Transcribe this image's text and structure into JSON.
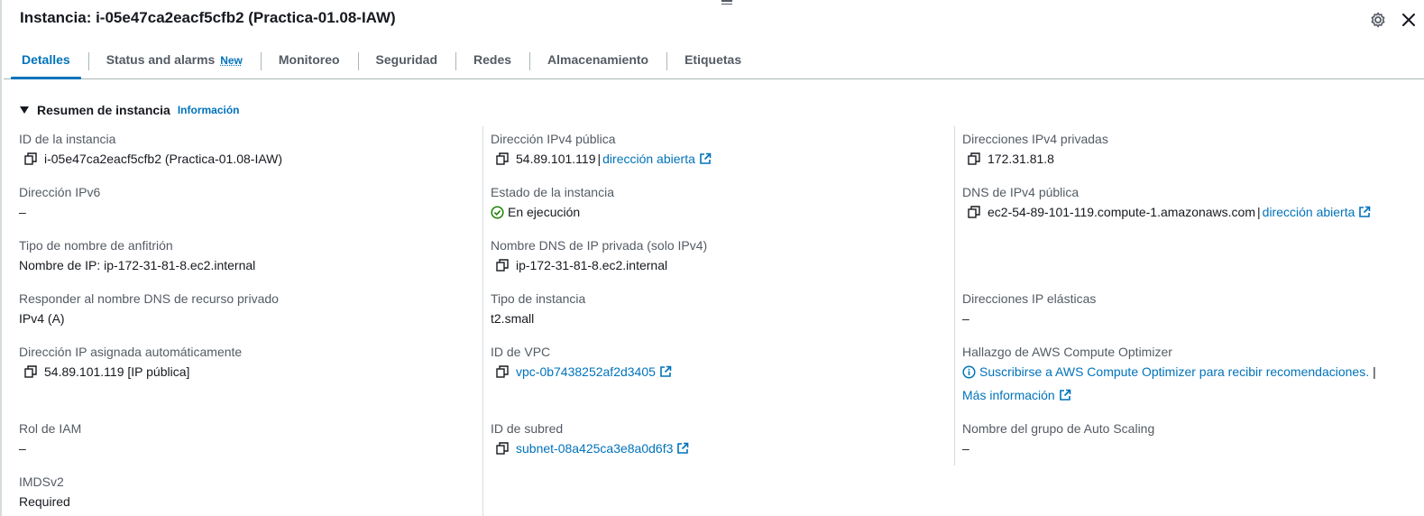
{
  "header": {
    "title": "Instancia: i-05e47ca2eacf5cfb2 (Practica-01.08-IAW)"
  },
  "tabs": [
    {
      "label": "Detalles",
      "active": true
    },
    {
      "label": "Status and alarms",
      "badge": "New"
    },
    {
      "label": "Monitoreo"
    },
    {
      "label": "Seguridad"
    },
    {
      "label": "Redes"
    },
    {
      "label": "Almacenamiento"
    },
    {
      "label": "Etiquetas"
    }
  ],
  "section": {
    "title": "Resumen de instancia",
    "info_link": "Información"
  },
  "col1": {
    "instance_id": {
      "label": "ID de la instancia",
      "value": "i-05e47ca2eacf5cfb2 (Practica-01.08-IAW)"
    },
    "ipv6": {
      "label": "Dirección IPv6",
      "value": "–"
    },
    "hostname_type": {
      "label": "Tipo de nombre de anfitrión",
      "value": "Nombre de IP: ip-172-31-81-8.ec2.internal"
    },
    "resource_dns": {
      "label": "Responder al nombre DNS de recurso privado",
      "value": "IPv4 (A)"
    },
    "auto_ip": {
      "label": "Dirección IP asignada automáticamente",
      "value": "54.89.101.119 [IP pública]"
    },
    "iam_role": {
      "label": "Rol de IAM",
      "value": "–"
    },
    "imds": {
      "label": "IMDSv2",
      "value": "Required"
    }
  },
  "col2": {
    "public_ipv4": {
      "label": "Dirección IPv4 pública",
      "value": "54.89.101.119",
      "sep": "|",
      "link": "dirección abierta"
    },
    "state": {
      "label": "Estado de la instancia",
      "value": "En ejecución"
    },
    "private_dns": {
      "label": "Nombre DNS de IP privada (solo IPv4)",
      "value": "ip-172-31-81-8.ec2.internal"
    },
    "instance_type": {
      "label": "Tipo de instancia",
      "value": "t2.small"
    },
    "vpc": {
      "label": "ID de VPC",
      "value": "vpc-0b7438252af2d3405"
    },
    "subnet": {
      "label": "ID de subred",
      "value": "subnet-08a425ca3e8a0d6f3"
    }
  },
  "col3": {
    "private_ipv4": {
      "label": "Direcciones IPv4 privadas",
      "value": "172.31.81.8"
    },
    "public_dns": {
      "label": "DNS de IPv4 pública",
      "value": "ec2-54-89-101-119.compute-1.amazonaws.com",
      "sep": "|",
      "link": "dirección abierta"
    },
    "elastic_ip": {
      "label": "Direcciones IP elásticas",
      "value": "–"
    },
    "optimizer": {
      "label": "Hallazgo de AWS Compute Optimizer",
      "link": "Suscribirse a AWS Compute Optimizer para recibir recomendaciones.",
      "sep": "|",
      "more": "Más información"
    },
    "asg": {
      "label": "Nombre del grupo de Auto Scaling",
      "value": "–"
    }
  },
  "colors": {
    "link": "#0073bb",
    "success": "#1d8102",
    "text": "#16191f",
    "muted": "#545b64"
  }
}
